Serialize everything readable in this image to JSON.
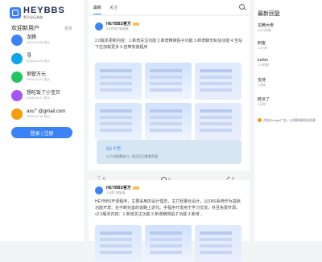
{
  "brand": {
    "name": "HEYBBS",
    "subtitle": "黑子论坛系统"
  },
  "left": {
    "title": "欢迎新用户",
    "more": "更多",
    "users": [
      {
        "name": "龙腾",
        "time": "2024-10-28 加入",
        "color": "#3b82f6"
      },
      {
        "name": "寻",
        "time": "2024-10-25 加入",
        "color": "#0ea5e9"
      },
      {
        "name": "钢管万元",
        "time": "2024-10-21 加入",
        "color": "#22c55e"
      },
      {
        "name": "想吃饭了小宝贝",
        "time": "2024-10-17 加入",
        "color": "#a855f7"
      },
      {
        "name": "axu''' @gmail.com",
        "time": "2024-10-16 加入",
        "color": "#f59e0b"
      }
    ],
    "login_label": "登录 | 注册"
  },
  "center": {
    "tabs": [
      "最新",
      "关注"
    ],
    "posts": [
      {
        "author": "HEYBBS官方",
        "time": "5小时前 电脑端",
        "text": "2.0版本更新内容：1.新增关注功能 2.新增精简贴子功能 3.新增聊天私信功能 4.全站下拉加载更多 5.自带安装程序",
        "paid_price": "50 Y币",
        "paid_tip": "以下内容需支付，购买后可查看资源"
      },
      {
        "author": "HEYBBS官方",
        "time": "1日前 电脑端",
        "text": "HEYBBS开源程序，主要采用的设计理念，主打轻量化设计，以SNS系统作为基础功能开发。在不断完善的道路上迭代。手程序开发用于学习交流，并且免费开源。v2.0版本内容：1.新增关注功能 2.新增精简贴子功能 3.新增..."
      }
    ],
    "footer": {
      "likes": "0",
      "comments": "0",
      "shares": "0"
    }
  },
  "right": {
    "title": "最新回复",
    "items": [
      {
        "name": "龙腾大佬",
        "text": "22小时前"
      },
      {
        "name": "刺客",
        "text": "12小时"
      },
      {
        "name": "luckin",
        "text": "1小时前"
      },
      {
        "name": "支持",
        "text": "1天前"
      },
      {
        "name": "欧派了",
        "text": "1天前"
      }
    ],
    "chat": "添加Google广告，以便释放网站资源"
  }
}
